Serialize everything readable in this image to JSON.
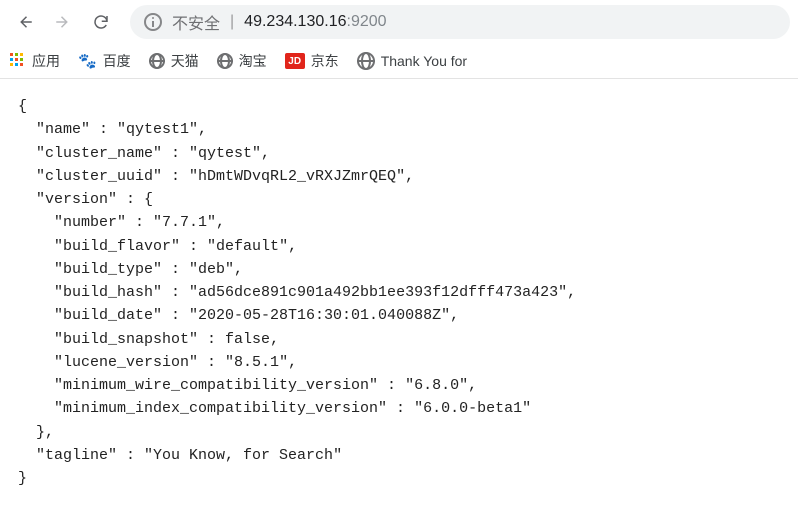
{
  "toolbar": {
    "insecure_label": "不安全",
    "host": "49.234.130.16",
    "port": ":9200"
  },
  "bookmarks": {
    "apps": "应用",
    "baidu": "百度",
    "tmall": "天猫",
    "taobao": "淘宝",
    "jd_icon": "JD",
    "jd": "京东",
    "thank": "Thank You for"
  },
  "response": {
    "name": "qytest1",
    "cluster_name": "qytest",
    "cluster_uuid": "hDmtWDvqRL2_vRXJZmrQEQ",
    "version": {
      "number": "7.7.1",
      "build_flavor": "default",
      "build_type": "deb",
      "build_hash": "ad56dce891c901a492bb1ee393f12dfff473a423",
      "build_date": "2020-05-28T16:30:01.040088Z",
      "build_snapshot": "false",
      "lucene_version": "8.5.1",
      "minimum_wire_compatibility_version": "6.8.0",
      "minimum_index_compatibility_version": "6.0.0-beta1"
    },
    "tagline": "You Know, for Search"
  }
}
